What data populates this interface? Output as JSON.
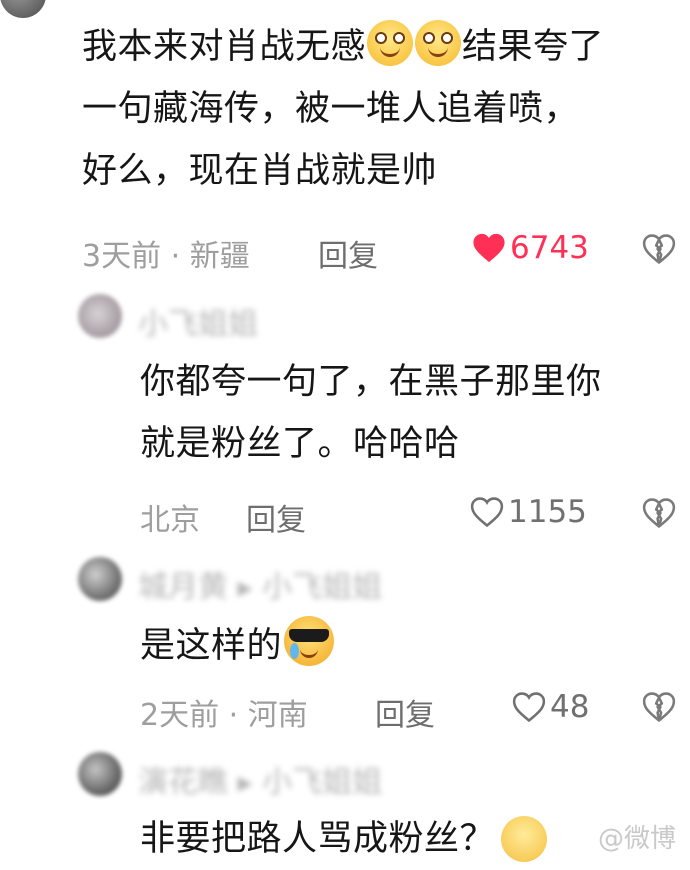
{
  "comments": [
    {
      "lines": [
        "我本来对肖战无感",
        "结果夸了",
        "一句藏海传，被一堆人追着喷，",
        "好么，现在肖战就是帅"
      ],
      "meta": "3天前 · 新疆",
      "reply_label": "回复",
      "likes": "6743",
      "liked": true,
      "emoji": "smile-emoji"
    },
    {
      "author": "小飞姐姐",
      "lines": [
        "你都夸一句了，在黑子那里你",
        "就是粉丝了。哈哈哈"
      ],
      "meta": "北京",
      "reply_label": "回复",
      "likes": "1155",
      "liked": false
    },
    {
      "author": "城月黄 ▸ 小飞姐姐",
      "lines": [
        "是这样的"
      ],
      "meta": "2天前 · 河南",
      "reply_label": "回复",
      "likes": "48",
      "liked": false,
      "emoji": "cool-crying-emoji"
    },
    {
      "author": "演花瞧 ▸ 小飞姐姐",
      "lines": [
        "非要把路人骂成粉丝？"
      ],
      "emoji": "sweat-smile-emoji"
    }
  ],
  "watermark": "@微博",
  "colors": {
    "like_active": "#ff2f55",
    "meta_gray": "#9e9e9e",
    "text": "#161616"
  }
}
